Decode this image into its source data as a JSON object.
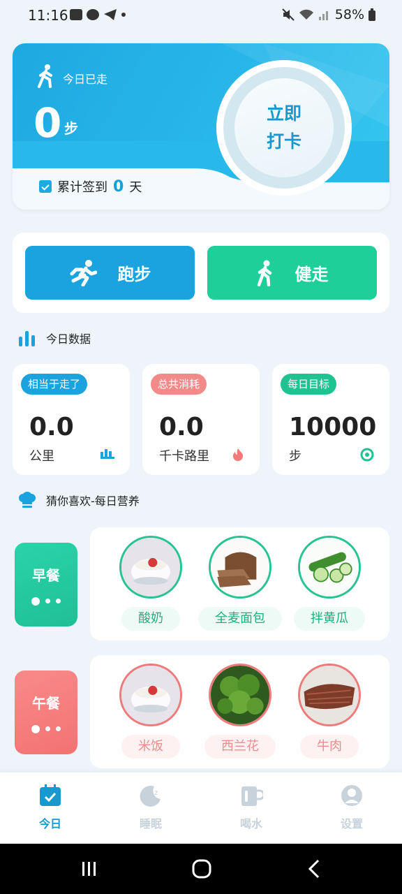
{
  "status_bar": {
    "time": "11:16",
    "battery": "58%"
  },
  "hero": {
    "today_walked_label": "今日已走",
    "steps": "0",
    "steps_unit": "步",
    "checkin_line1": "立即",
    "checkin_line2": "打卡",
    "cumulative_label": "累计签到",
    "cumulative_days": "0",
    "cumulative_unit": "天"
  },
  "activities": {
    "run_label": "跑步",
    "walk_label": "健走"
  },
  "today_data": {
    "title": "今日数据",
    "cards": [
      {
        "tag": "相当于走了",
        "value": "0.0",
        "unit": "公里",
        "color": "#1ba3e0"
      },
      {
        "tag": "总共消耗",
        "value": "0.0",
        "unit": "千卡路里",
        "color": "#f28a8a"
      },
      {
        "tag": "每日目标",
        "value": "10000",
        "unit": "步",
        "color": "#1fc291"
      }
    ]
  },
  "nutrition": {
    "title": "猜你喜欢-每日营养",
    "breakfast": {
      "label": "早餐",
      "color": "#22c9a0",
      "foods": [
        "酸奶",
        "全麦面包",
        "拌黄瓜"
      ]
    },
    "lunch": {
      "label": "午餐",
      "color": "#f47a7a",
      "foods": [
        "米饭",
        "西兰花",
        "牛肉"
      ]
    }
  },
  "bottom_nav": {
    "items": [
      {
        "label": "今日",
        "active": true
      },
      {
        "label": "睡眠",
        "active": false
      },
      {
        "label": "喝水",
        "active": false
      },
      {
        "label": "设置",
        "active": false
      }
    ]
  },
  "colors": {
    "accent_blue": "#1ba3e0",
    "accent_green": "#1fcf9a",
    "accent_red": "#f47a7a"
  }
}
